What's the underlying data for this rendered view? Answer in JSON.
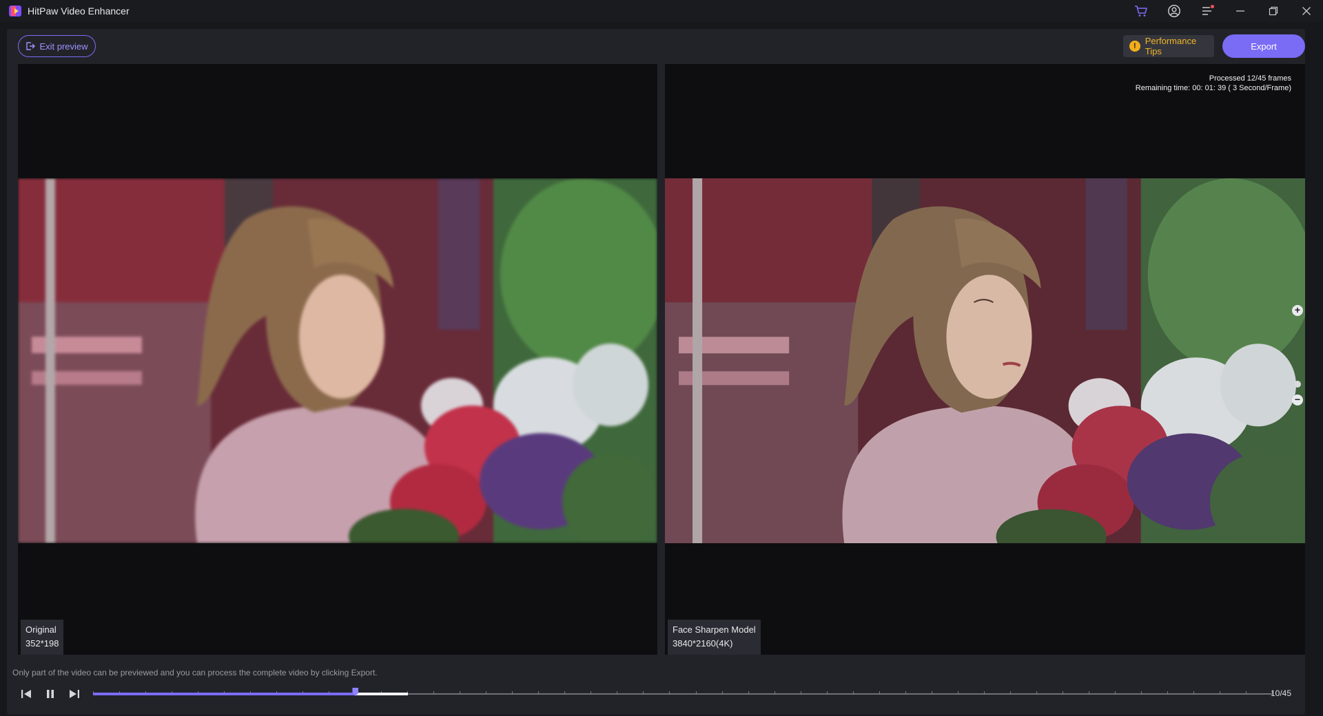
{
  "window": {
    "title": "HitPaw Video Enhancer",
    "icons": [
      "cart-icon",
      "account-icon",
      "menu-icon",
      "minimize-icon",
      "restore-icon",
      "close-icon"
    ],
    "colors": {
      "accent": "#7b6cf6",
      "warning": "#f3ad1c",
      "notification": "#ff4d5a"
    }
  },
  "toolbar": {
    "exit_label": "Exit preview",
    "tips_label": "Performance Tips",
    "export_label": "Export"
  },
  "preview": {
    "original": {
      "title": "Original",
      "resolution": "352*198"
    },
    "enhanced": {
      "title": "Face Sharpen Model",
      "resolution": "3840*2160(4K)"
    },
    "progress": {
      "processed": "Processed 12/45 frames",
      "remaining": "Remaining time: 00: 01: 39 ( 3 Second/Frame)"
    }
  },
  "player": {
    "hint": "Only part of the video can be previewed and you can process the complete video by clicking Export.",
    "counter": "10/45",
    "total_frames": 45,
    "current_frame": 10,
    "processed_frames": 12
  }
}
